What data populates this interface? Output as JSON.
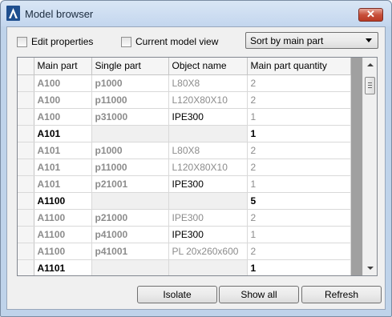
{
  "window": {
    "title": "Model browser",
    "close_glyph": "✕"
  },
  "options": {
    "edit_properties": "Edit properties",
    "current_model_view": "Current model view",
    "sort_selected": "Sort by main part"
  },
  "grid": {
    "columns": [
      "Main part",
      "Single part",
      "Object name",
      "Main part quantity"
    ],
    "rows": [
      {
        "main_part": "A100",
        "single_part": "p1000",
        "object_name": "L80X8",
        "quantity": "2"
      },
      {
        "main_part": "A100",
        "single_part": "p11000",
        "object_name": "L120X80X10",
        "quantity": "2"
      },
      {
        "main_part": "A100",
        "single_part": "p31000",
        "object_name": "IPE300",
        "quantity": "1"
      },
      {
        "main_part": "A101",
        "single_part": "",
        "object_name": "",
        "quantity": "1"
      },
      {
        "main_part": "A101",
        "single_part": "p1000",
        "object_name": "L80X8",
        "quantity": "2"
      },
      {
        "main_part": "A101",
        "single_part": "p11000",
        "object_name": "L120X80X10",
        "quantity": "2"
      },
      {
        "main_part": "A101",
        "single_part": "p21001",
        "object_name": "IPE300",
        "quantity": "1"
      },
      {
        "main_part": "A1100",
        "single_part": "",
        "object_name": "",
        "quantity": "5"
      },
      {
        "main_part": "A1100",
        "single_part": "p21000",
        "object_name": "IPE300",
        "quantity": "2"
      },
      {
        "main_part": "A1100",
        "single_part": "p41000",
        "object_name": "IPE300",
        "quantity": "1"
      },
      {
        "main_part": "A1100",
        "single_part": "p41001",
        "object_name": "PL 20x260x600",
        "quantity": "2"
      },
      {
        "main_part": "A1101",
        "single_part": "",
        "object_name": "",
        "quantity": "1"
      }
    ]
  },
  "buttons": {
    "isolate": "Isolate",
    "show_all": "Show all",
    "refresh": "Refresh"
  },
  "colors": {
    "close_button": "#c8503b",
    "dimmed_text": "#8c8c8c",
    "grid_filler": "#a0a0a0"
  }
}
